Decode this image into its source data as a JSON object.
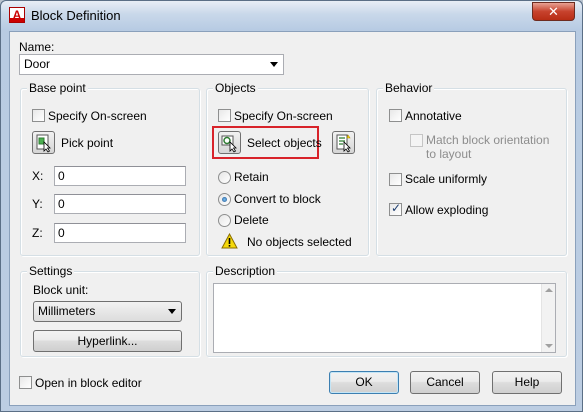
{
  "window": {
    "title": "Block Definition",
    "close_glyph": "✕"
  },
  "name": {
    "label": "Name:",
    "value": "Door"
  },
  "base_point": {
    "title": "Base point",
    "specify_on_screen": "Specify On-screen",
    "pick_point": "Pick point",
    "x_label": "X:",
    "x_value": "0",
    "y_label": "Y:",
    "y_value": "0",
    "z_label": "Z:",
    "z_value": "0"
  },
  "objects": {
    "title": "Objects",
    "specify_on_screen": "Specify On-screen",
    "select_objects": "Select objects",
    "retain": "Retain",
    "convert_to_block": "Convert to block",
    "delete": "Delete",
    "status": "No objects selected",
    "selected_option": "Convert to block"
  },
  "behavior": {
    "title": "Behavior",
    "annotative": "Annotative",
    "match_orientation": "Match block orientation to layout",
    "scale_uniformly": "Scale uniformly",
    "allow_exploding": "Allow exploding",
    "allow_exploding_checked": true
  },
  "settings": {
    "title": "Settings",
    "block_unit_label": "Block unit:",
    "block_unit_value": "Millimeters",
    "hyperlink_button": "Hyperlink..."
  },
  "description": {
    "title": "Description",
    "value": ""
  },
  "footer": {
    "open_in_block_editor": "Open in block editor",
    "ok": "OK",
    "cancel": "Cancel",
    "help": "Help"
  },
  "colors": {
    "highlight": "#d8232a",
    "warning": "#f5d90a"
  }
}
